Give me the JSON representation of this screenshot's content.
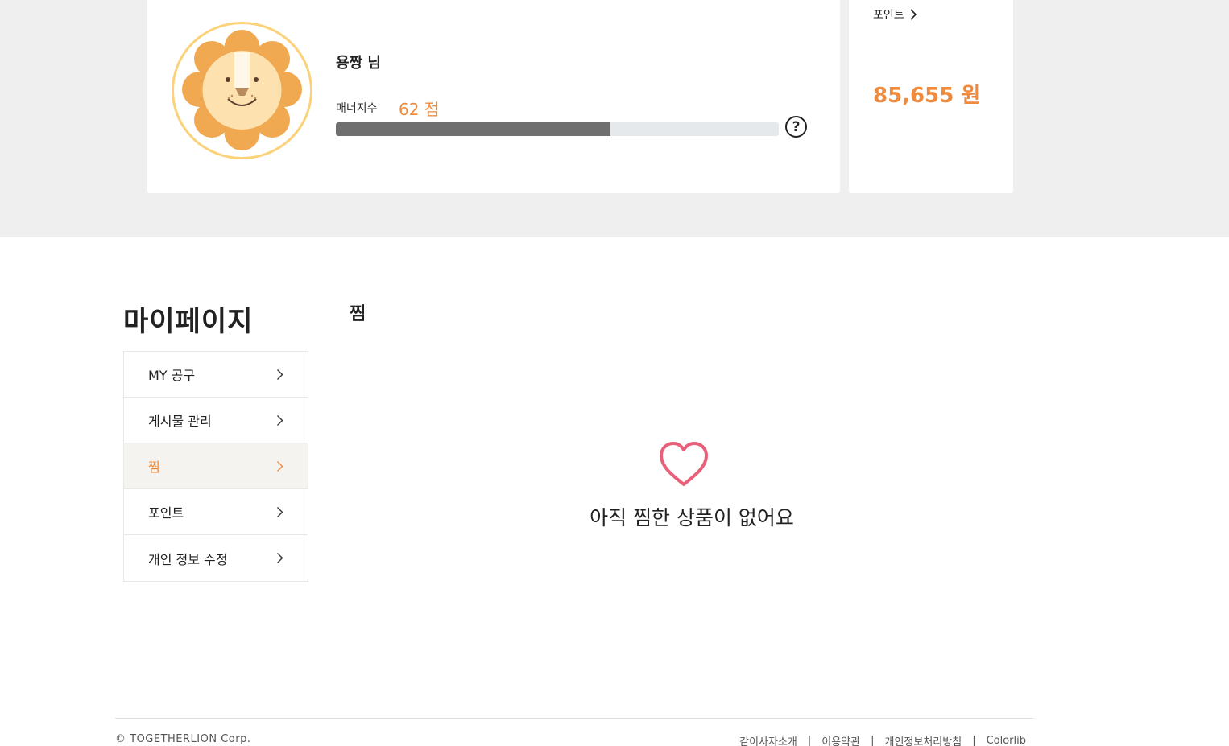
{
  "profile": {
    "name": "용짱 님",
    "manner_label": "매너지수",
    "manner_score": "62 점",
    "manner_fraction": 0.62,
    "avatar_icon": "lion-avatar-icon"
  },
  "points": {
    "link_label": "포인트",
    "amount": "85,655 원"
  },
  "sidebar": {
    "title": "마이페이지",
    "items": [
      {
        "label": "MY 공구",
        "active": false
      },
      {
        "label": "게시물 관리",
        "active": false
      },
      {
        "label": "찜",
        "active": true
      },
      {
        "label": "포인트",
        "active": false
      },
      {
        "label": "개인 정보 수정",
        "active": false
      }
    ]
  },
  "content": {
    "title": "찜",
    "empty_message": "아직 찜한 상품이 없어요"
  },
  "footer": {
    "copyright": "© TOGETHERLION Corp.",
    "links": [
      "같이사자소개",
      "이용약관",
      "개인정보처리방침",
      "Colorlib"
    ]
  },
  "colors": {
    "accent": "#f08a3c",
    "heart": "#e8607a",
    "bar_fill": "#6f6f6f",
    "bar_track": "#e6e9ec",
    "page_bg_band": "#efefef"
  }
}
